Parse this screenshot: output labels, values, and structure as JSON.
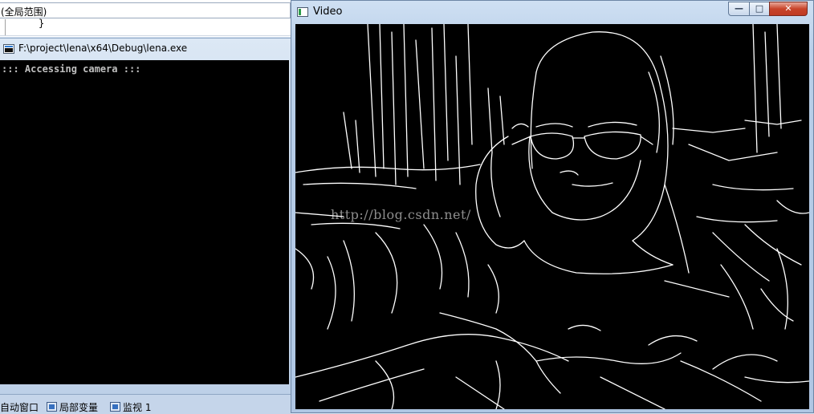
{
  "ide": {
    "scope_combo": "(全局范围)",
    "code_brace": "}"
  },
  "console": {
    "title": "F:\\project\\lena\\x64\\Debug\\lena.exe",
    "output": "::: Accessing camera :::"
  },
  "bottom_tabs": [
    {
      "label": "自动窗口",
      "icon": "autos-window-icon"
    },
    {
      "label": "局部变量",
      "icon": "locals-window-icon"
    },
    {
      "label": "监视 1",
      "icon": "watch-window-icon"
    }
  ],
  "video": {
    "title": "Video",
    "buttons": {
      "minimize": "—",
      "maximize": "□",
      "close": "✕"
    },
    "watermark": "http://blog.csdn.net/"
  },
  "colors": {
    "console_bg": "#000000",
    "console_text": "#c0c0c0",
    "edges": "#ffffff",
    "close_button": "#c8442b"
  }
}
